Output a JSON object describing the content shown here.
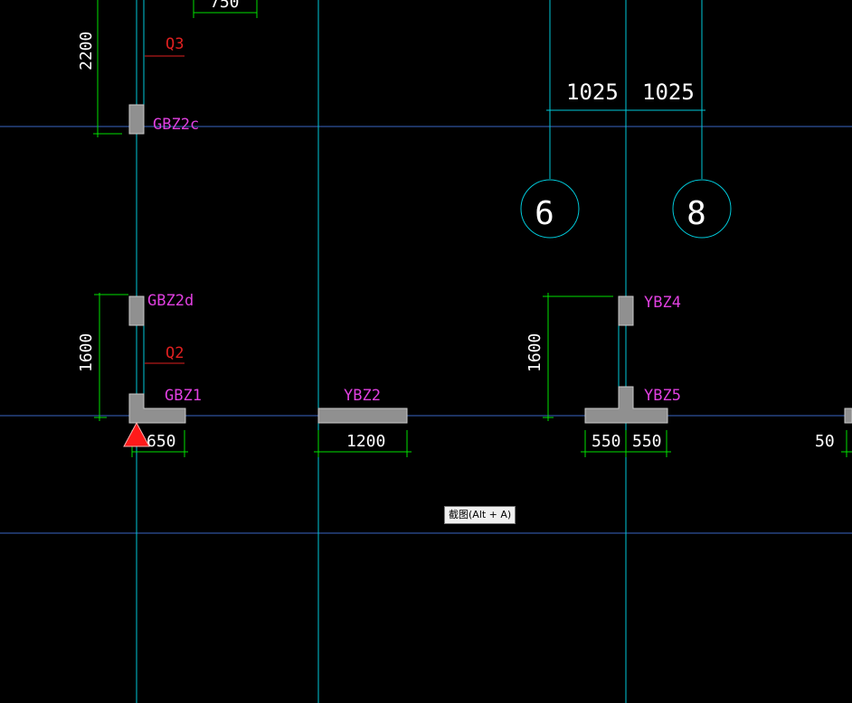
{
  "colors": {
    "background": "#000000",
    "axis_line": "#3a66c4",
    "column_line": "#00c8d8",
    "dimension_line": "#00e000",
    "label_magenta": "#e040e0",
    "label_red": "#e02020",
    "wall_fill": "#909090",
    "axis_bubble": "#00c8d8",
    "cursor_marker": "#ff1a1a"
  },
  "dimensions": {
    "d_top_partial": "750",
    "d_2200": "2200",
    "d_1025_left": "1025",
    "d_1025_right": "1025",
    "d_1600_left": "1600",
    "d_1600_right": "1600",
    "d_650": "650",
    "d_1200": "1200",
    "d_550_left": "550",
    "d_550_right": "550",
    "d_50_edge": "50"
  },
  "labels": {
    "q3": "Q3",
    "gbz2c": "GBZ2c",
    "gbz2d": "GBZ2d",
    "q2": "Q2",
    "gbz1": "GBZ1",
    "ybz2": "YBZ2",
    "ybz4": "YBZ4",
    "ybz5": "YBZ5"
  },
  "axis_bubbles": {
    "axis_6": "6",
    "axis_8": "8"
  },
  "tooltip": {
    "text": "截图(Alt + A)"
  },
  "icons": {
    "cursor_marker": "warning-triangle-icon"
  }
}
